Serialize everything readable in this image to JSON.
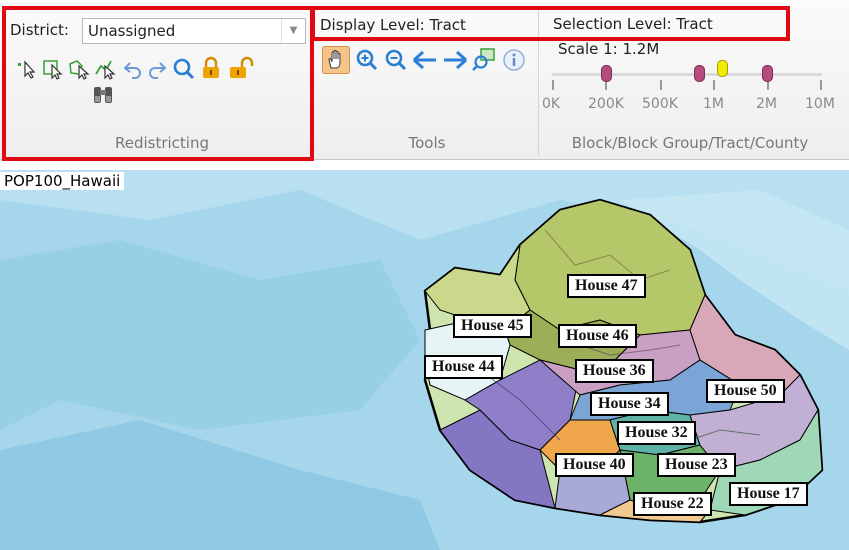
{
  "ribbon": {
    "district_label": "District:",
    "district_value": "Unassigned",
    "display_level": "Display Level: Tract",
    "selection_level": "Selection Level: Tract",
    "scale": "Scale 1: 1.2M",
    "groups": {
      "redistricting": "Redistricting",
      "tools": "Tools",
      "levels": "Block/Block Group/Tract/County"
    },
    "slider": {
      "ticks": [
        "0K",
        "200K",
        "500K",
        "1M",
        "2M",
        "10M"
      ],
      "thumbs": [
        {
          "color": "#b54b7f",
          "value": "200K"
        },
        {
          "color": "#b54b7f",
          "value": "1M"
        },
        {
          "color": "#f2ec00",
          "value": "1.2M"
        },
        {
          "color": "#b54b7f",
          "value": "2M"
        }
      ]
    },
    "redistricting_tools": [
      "select-point-icon",
      "select-rectangle-icon",
      "select-polygon-icon",
      "select-line-icon",
      "undo-icon",
      "redo-icon",
      "find-icon",
      "lock-icon",
      "unlock-icon",
      "binoculars-icon"
    ],
    "map_tools": [
      "pan-hand-icon",
      "zoom-in-icon",
      "zoom-out-icon",
      "back-arrow-icon",
      "forward-arrow-icon",
      "zoom-extent-icon",
      "info-icon"
    ]
  },
  "map": {
    "layer_title": "POP100_Hawaii",
    "labels": [
      "House 47",
      "House 45",
      "House 46",
      "House 44",
      "House 36",
      "House 50",
      "House 34",
      "House 32",
      "House 40",
      "House 23",
      "House 17",
      "House 22"
    ]
  }
}
